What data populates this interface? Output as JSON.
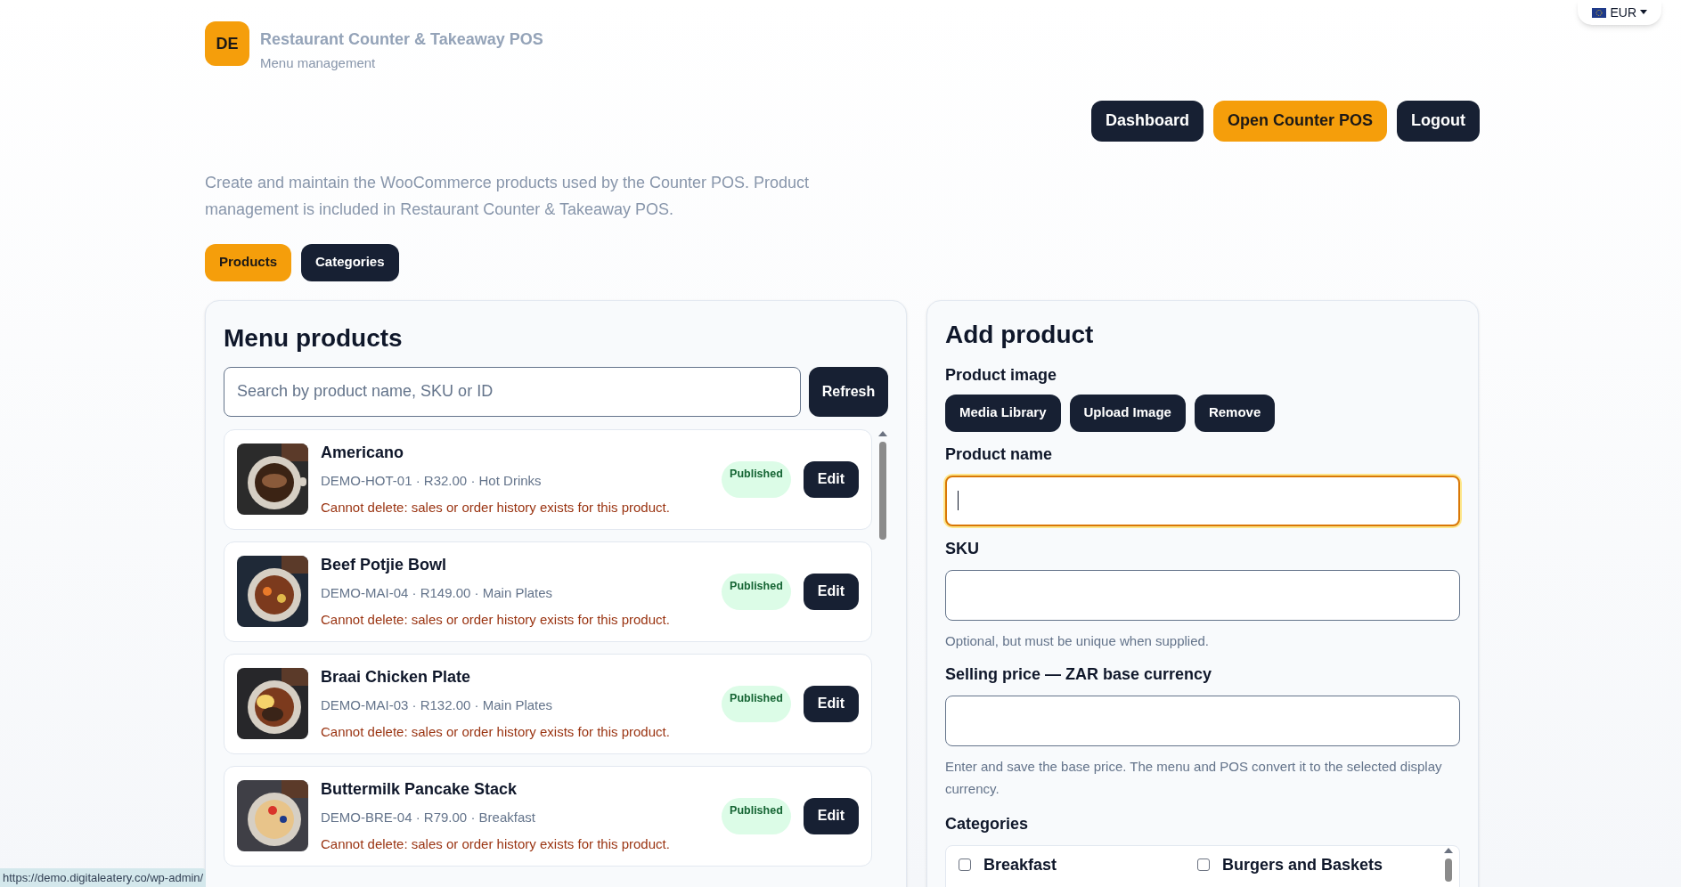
{
  "header": {
    "badge": "DE",
    "title": "Restaurant Counter & Takeaway POS",
    "subtitle": "Menu management"
  },
  "currency": {
    "code": "EUR"
  },
  "nav_buttons": [
    {
      "label": "Dashboard",
      "kind": "dark"
    },
    {
      "label": "Open Counter POS",
      "kind": "accent"
    },
    {
      "label": "Logout",
      "kind": "dark"
    }
  ],
  "description": "Create and maintain the WooCommerce products used by the Counter POS. Product management is included in Restaurant Counter & Takeaway POS.",
  "tabs": [
    {
      "label": "Products",
      "selected": true
    },
    {
      "label": "Categories",
      "selected": false
    }
  ],
  "products_panel": {
    "title": "Menu products",
    "search": {
      "placeholder": "Search by product name, SKU or ID"
    },
    "refresh": "Refresh",
    "items": [
      {
        "name": "Americano",
        "meta": "DEMO-HOT-01 · R32.00 · Hot Drinks",
        "warning": "Cannot delete: sales or order history exists for this product.",
        "status": "Published",
        "action": "Edit"
      },
      {
        "name": "Beef Potjie Bowl",
        "meta": "DEMO-MAI-04 · R149.00 · Main Plates",
        "warning": "Cannot delete: sales or order history exists for this product.",
        "status": "Published",
        "action": "Edit"
      },
      {
        "name": "Braai Chicken Plate",
        "meta": "DEMO-MAI-03 · R132.00 · Main Plates",
        "warning": "Cannot delete: sales or order history exists for this product.",
        "status": "Published",
        "action": "Edit"
      },
      {
        "name": "Buttermilk Pancake Stack",
        "meta": "DEMO-BRE-04 · R79.00 · Breakfast",
        "warning": "Cannot delete: sales or order history exists for this product.",
        "status": "Published",
        "action": "Edit"
      }
    ]
  },
  "add_product": {
    "title": "Add product",
    "image_label": "Product image",
    "image_buttons": [
      "Media Library",
      "Upload Image",
      "Remove"
    ],
    "fields": [
      {
        "label": "Product name",
        "focused": true
      },
      {
        "label": "SKU",
        "hint": "Optional, but must be unique when supplied.",
        "focused": false
      },
      {
        "label": "Selling price — ZAR base currency",
        "hint": "Enter and save the base price. The menu and POS convert it to the selected display currency.",
        "focused": false
      }
    ],
    "categories": {
      "label": "Categories",
      "items": [
        {
          "label": "Breakfast",
          "checked": false
        },
        {
          "label": "Burgers and Baskets",
          "checked": false
        }
      ]
    }
  },
  "status_bar": {
    "url": "https://demo.digitaleatery.co/wp-admin/"
  }
}
